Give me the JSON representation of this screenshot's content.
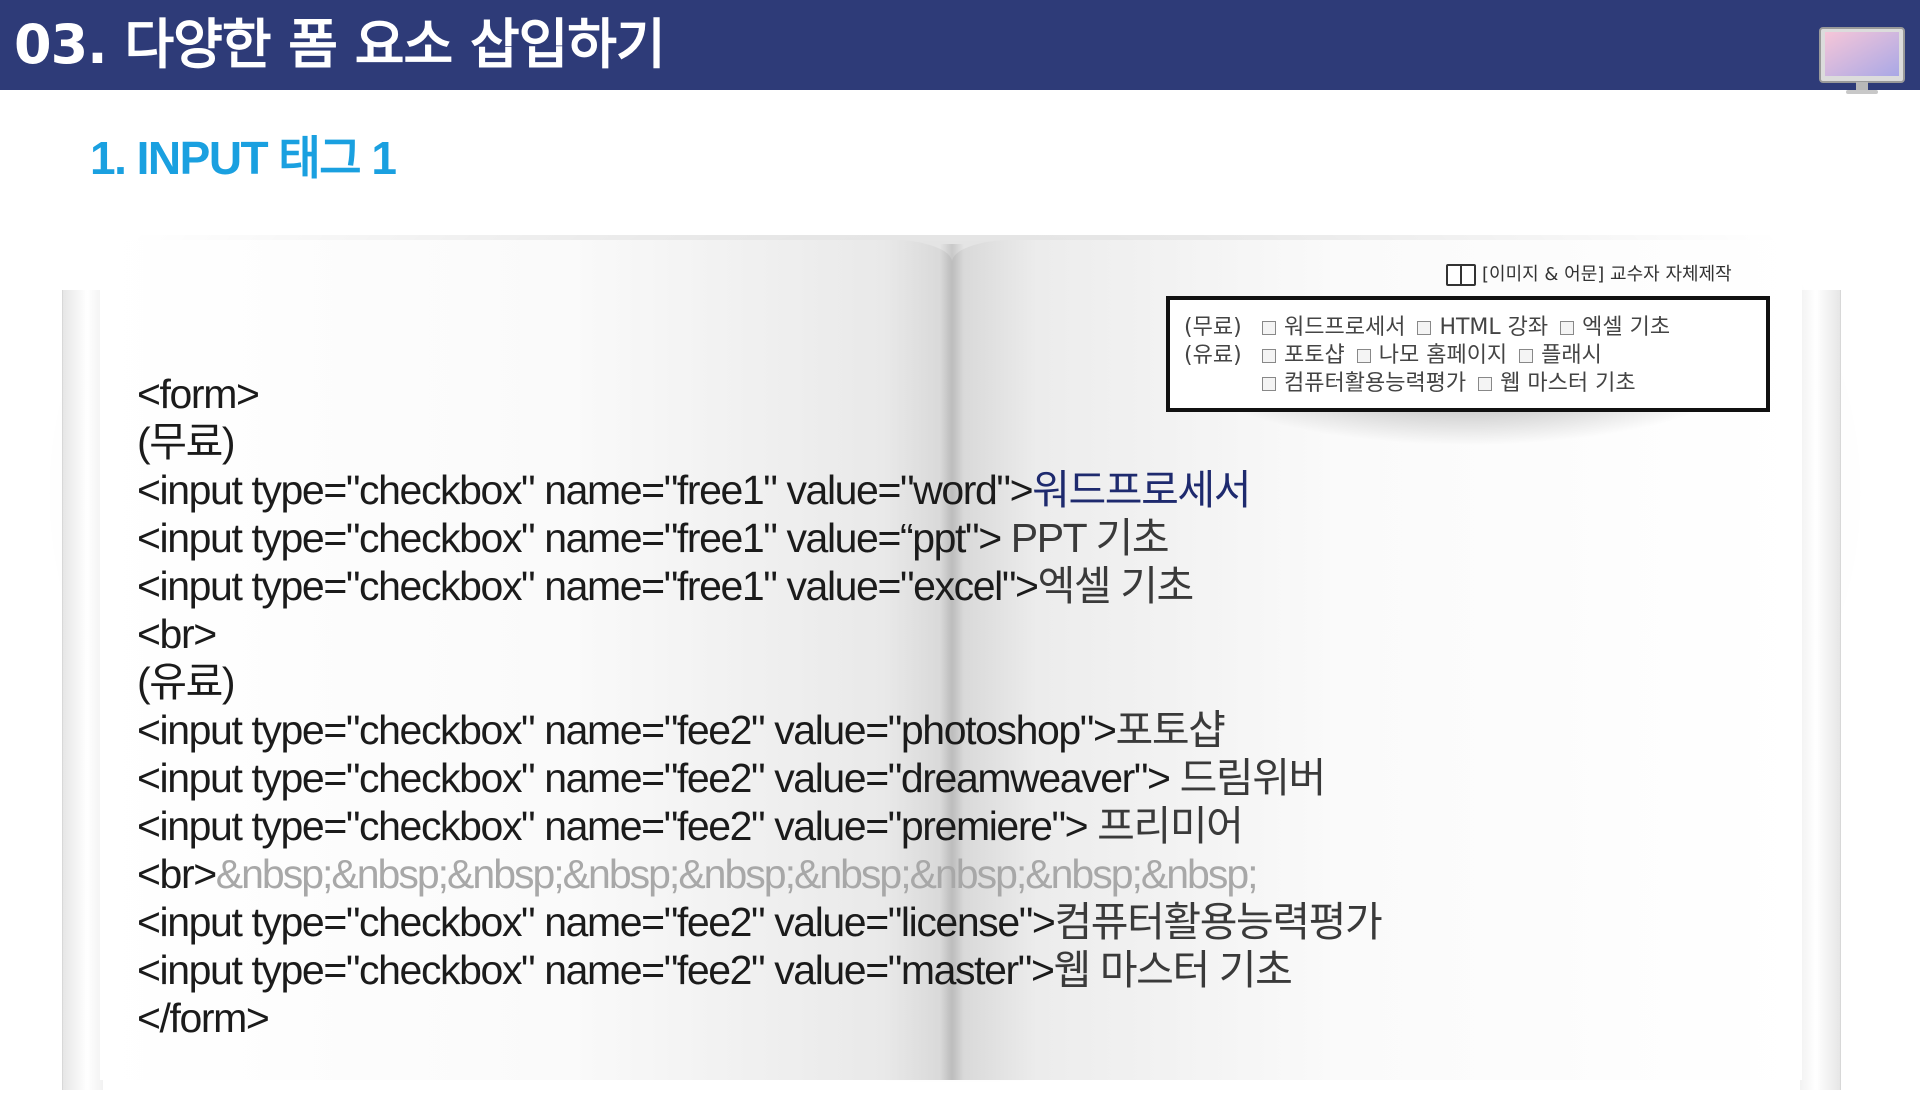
{
  "header": {
    "title": "03. 다양한 폼 요소 삽입하기",
    "bg_color": "#2e3b78",
    "icon": "monitor-icon"
  },
  "subtitle": "1. INPUT 태그 1",
  "credit": {
    "icon": "book-icon",
    "text": "[이미지 & 어문] 교수자 자체제작"
  },
  "preview": {
    "rows": [
      {
        "label": "(무료)",
        "options": [
          "워드프로세서",
          "HTML 강좌",
          "엑셀 기초"
        ]
      },
      {
        "label": "(유료)",
        "options": [
          "포토샵",
          "나모 홈페이지",
          "플래시"
        ]
      },
      {
        "label": "",
        "options": [
          "컴퓨터활용능력평가",
          "웹 마스터 기초"
        ]
      }
    ]
  },
  "code": {
    "form_open": "<form>",
    "free_label": "(무료)",
    "line_word": "<input type=\"checkbox\" name=\"free1\" value=\"word\">",
    "text_word": "워드프로세서",
    "line_ppt": "<input type=\"checkbox\" name=\"free1\" value=“ppt\">",
    "text_ppt": " PPT 기초",
    "line_excel": "<input type=\"checkbox\" name=\"free1\" value=\"excel\">",
    "text_excel": "엑셀 기초",
    "br": "<br>",
    "fee_label": "(유료)",
    "line_photoshop": "<input type=\"checkbox\" name=\"fee2\" value=\"photoshop\">",
    "text_photoshop": "포토샵",
    "line_dreamweaver": "<input type=\"checkbox\" name=\"fee2\" value=\"dreamweaver\">",
    "text_dreamweaver": " 드림위버",
    "line_premiere": "<input type=\"checkbox\" name=\"fee2\" value=\"premiere\">",
    "text_premiere": " 프리미어",
    "br2": "<br>",
    "nbsp": "&nbsp;&nbsp;&nbsp;&nbsp;&nbsp;&nbsp;&nbsp;&nbsp;&nbsp;",
    "line_license": "<input type=\"checkbox\" name=\"fee2\" value=\"license\">",
    "text_license": "컴퓨터활용능력평가",
    "line_master": "<input type=\"checkbox\" name=\"fee2\" value=\"master\">",
    "text_master": "웹 마스터 기초",
    "form_close": "</form>"
  },
  "colors": {
    "subtitle": "#1aa0e0",
    "code_text": "#1b1b1b",
    "nbsp_text": "#a8a8a8"
  }
}
